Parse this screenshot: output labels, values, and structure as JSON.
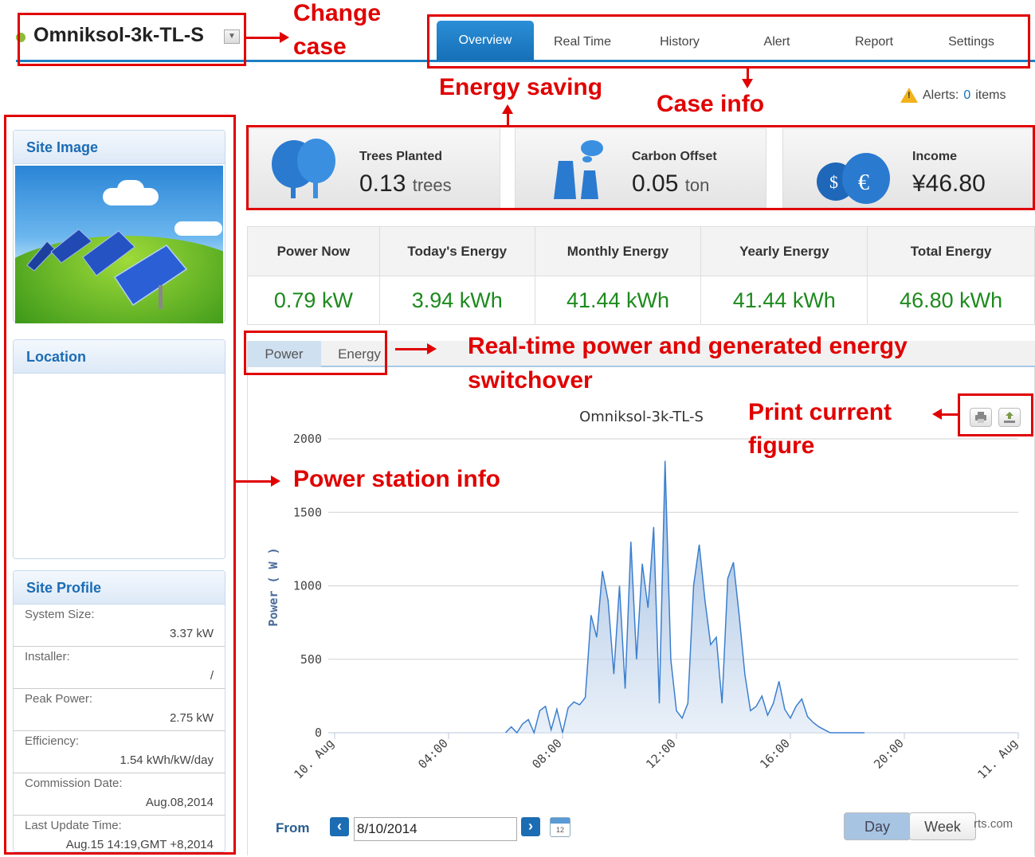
{
  "header": {
    "site_name": "Omniksol-3k-TL-S",
    "tabs": [
      "Overview",
      "Real Time",
      "History",
      "Alert",
      "Report",
      "Settings"
    ],
    "active_tab": "Overview",
    "alerts_label": "Alerts:",
    "alerts_count": "0",
    "alerts_unit": "items"
  },
  "sidebar": {
    "site_image_title": "Site Image",
    "location_title": "Location",
    "profile_title": "Site Profile",
    "profile": [
      {
        "label": "System Size:",
        "value": "3.37 kW"
      },
      {
        "label": "Installer:",
        "value": "/"
      },
      {
        "label": "Peak Power:",
        "value": "2.75 kW"
      },
      {
        "label": "Efficiency:",
        "value": "1.54 kWh/kW/day"
      },
      {
        "label": "Commission Date:",
        "value": "Aug.08,2014"
      },
      {
        "label": "Last Update Time:",
        "value": "Aug.15 14:19,GMT +8,2014"
      }
    ]
  },
  "savings": {
    "trees_label": "Trees Planted",
    "trees_value": "0.13",
    "trees_unit": "trees",
    "carbon_label": "Carbon Offset",
    "carbon_value": "0.05",
    "carbon_unit": "ton",
    "income_label": "Income",
    "income_value": "¥46.80"
  },
  "stats": {
    "headers": [
      "Power Now",
      "Today's Energy",
      "Monthly Energy",
      "Yearly Energy",
      "Total Energy"
    ],
    "values": [
      "0.79 kW",
      "3.94 kWh",
      "41.44 kWh",
      "41.44 kWh",
      "46.80 kWh"
    ]
  },
  "chart_tabs": [
    "Power",
    "Energy"
  ],
  "chart_controls": {
    "from_label": "From",
    "date": "8/10/2014",
    "calendar_day": "12",
    "range_buttons": [
      "Day",
      "Week"
    ],
    "credit": "rts.com"
  },
  "annotations": {
    "change_case": "Change\ncase",
    "energy_saving": "Energy saving",
    "case_info": "Case info",
    "power_station_info": "Power station info",
    "switchover_1": "Real-time power and generated energy",
    "switchover_2": "switchover",
    "print_1": "Print current",
    "print_2": "figure"
  },
  "colors": {
    "accent": "#1c7ec4",
    "value_green": "#1d8a1d",
    "annotation_red": "#e00000",
    "series_line": "#3b7fcf"
  },
  "chart_data": {
    "type": "area",
    "title": "Omniksol-3k-TL-S",
    "ylabel": "Power ( W )",
    "xlabel": "",
    "ylim": [
      0,
      2000
    ],
    "yticks": [
      0,
      500,
      1000,
      1500,
      2000
    ],
    "xticks": [
      "10. Aug",
      "04:00",
      "08:00",
      "12:00",
      "16:00",
      "20:00",
      "11. Aug"
    ],
    "grid": true,
    "series": [
      {
        "x": [
          6.0,
          6.2,
          6.4,
          6.6,
          6.8,
          7.0,
          7.2,
          7.4,
          7.6,
          7.8,
          8.0,
          8.2,
          8.4,
          8.6,
          8.8,
          9.0,
          9.2,
          9.4,
          9.6,
          9.8,
          10.0,
          10.2,
          10.4,
          10.6,
          10.8,
          11.0,
          11.2,
          11.4,
          11.6,
          11.8,
          12.0,
          12.2,
          12.4,
          12.6,
          12.8,
          13.0,
          13.2,
          13.4,
          13.6,
          13.8,
          14.0,
          14.2,
          14.4,
          14.6,
          14.8,
          15.0,
          15.2,
          15.4,
          15.6,
          15.8,
          16.0,
          16.2,
          16.4,
          16.6,
          16.8,
          17.0,
          17.2,
          17.4,
          17.6,
          17.8,
          18.0,
          18.2,
          18.4,
          18.6
        ],
        "values": [
          0,
          40,
          0,
          60,
          90,
          0,
          150,
          180,
          20,
          160,
          0,
          170,
          210,
          190,
          240,
          800,
          650,
          1100,
          900,
          400,
          1000,
          300,
          1300,
          500,
          1150,
          850,
          1400,
          200,
          1850,
          500,
          150,
          100,
          200,
          1000,
          1280,
          900,
          600,
          650,
          200,
          1050,
          1160,
          800,
          400,
          150,
          180,
          250,
          120,
          200,
          350,
          160,
          100,
          180,
          230,
          110,
          70,
          40,
          20,
          0,
          0,
          0,
          0,
          0,
          0,
          0
        ]
      }
    ]
  }
}
